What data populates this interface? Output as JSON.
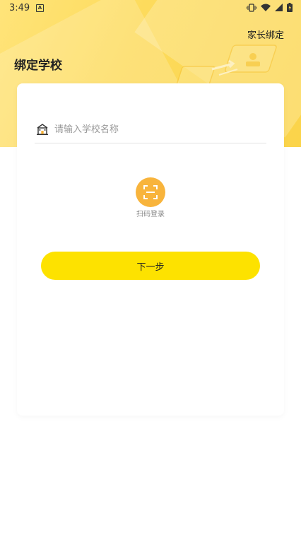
{
  "status_bar": {
    "time": "3:49",
    "notification_letter": "A"
  },
  "header": {
    "title": "绑定学校",
    "parent_bind_label": "家长绑定"
  },
  "search": {
    "placeholder": "请输入学校名称",
    "value": ""
  },
  "scan": {
    "label": "扫码登录"
  },
  "next_button": {
    "label": "下一步"
  },
  "colors": {
    "header_yellow": "#fbd44a",
    "scan_orange": "#f8b43c",
    "button_yellow": "#fde200"
  }
}
